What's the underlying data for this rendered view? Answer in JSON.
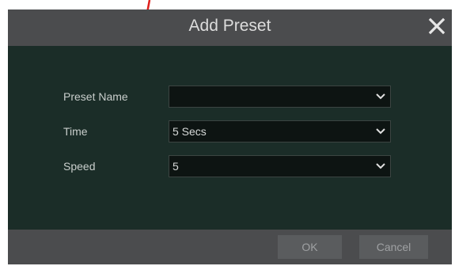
{
  "dialog": {
    "title": "Add Preset",
    "close_icon": "close-icon",
    "fields": [
      {
        "label": "Preset Name",
        "value": ""
      },
      {
        "label": "Time",
        "value": "5 Secs"
      },
      {
        "label": "Speed",
        "value": "5"
      }
    ],
    "buttons": {
      "ok": "OK",
      "cancel": "Cancel"
    }
  },
  "colors": {
    "title_bar": "#4b4c4e",
    "body": "#1b2d28",
    "annotation_arrow": "#e0201c"
  }
}
